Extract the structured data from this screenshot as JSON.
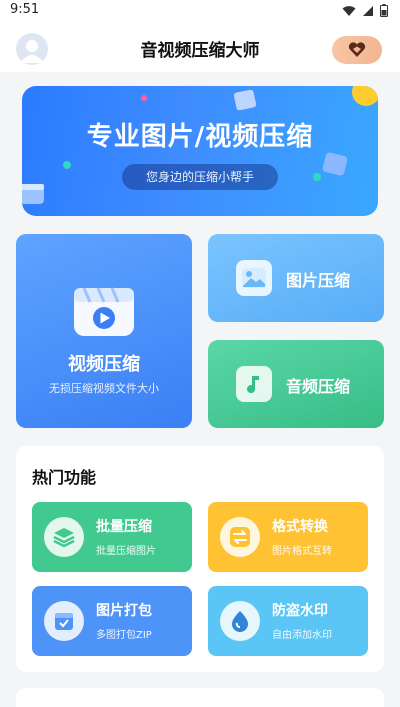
{
  "status_bar": {
    "time": "9:51",
    "icons": [
      "wifi-icon",
      "signal-icon",
      "battery-icon"
    ]
  },
  "header": {
    "title": "音视频压缩大师",
    "avatar_icon": "user-avatar-icon",
    "vip_icon": "heart-gem-icon"
  },
  "banner": {
    "title": "专业图片/视频压缩",
    "subtitle": "您身边的压缩小帮手"
  },
  "tools": {
    "video": {
      "label": "视频压缩",
      "sub": "无损压缩视频文件大小",
      "icon": "video-clapper-icon"
    },
    "image": {
      "label": "图片压缩",
      "icon": "image-icon"
    },
    "audio": {
      "label": "音频压缩",
      "icon": "music-note-icon"
    }
  },
  "hot": {
    "title": "热门功能",
    "items": [
      {
        "title": "批量压缩",
        "sub": "批量压缩图片",
        "icon": "layers-icon",
        "color": "#42c98f"
      },
      {
        "title": "格式转换",
        "sub": "图片格式互转",
        "icon": "convert-icon",
        "color": "#ffc233"
      },
      {
        "title": "图片打包",
        "sub": "多图打包ZIP",
        "icon": "package-icon",
        "color": "#4e93f7"
      },
      {
        "title": "防盗水印",
        "sub": "自由添加水印",
        "icon": "watermark-icon",
        "color": "#5bc6f5"
      }
    ]
  },
  "colors": {
    "banner": "#2b7bff",
    "vip": "#f3b591",
    "video_card": "#3b7ff5",
    "image_card": "#56adf7",
    "audio_card": "#37bd86"
  }
}
